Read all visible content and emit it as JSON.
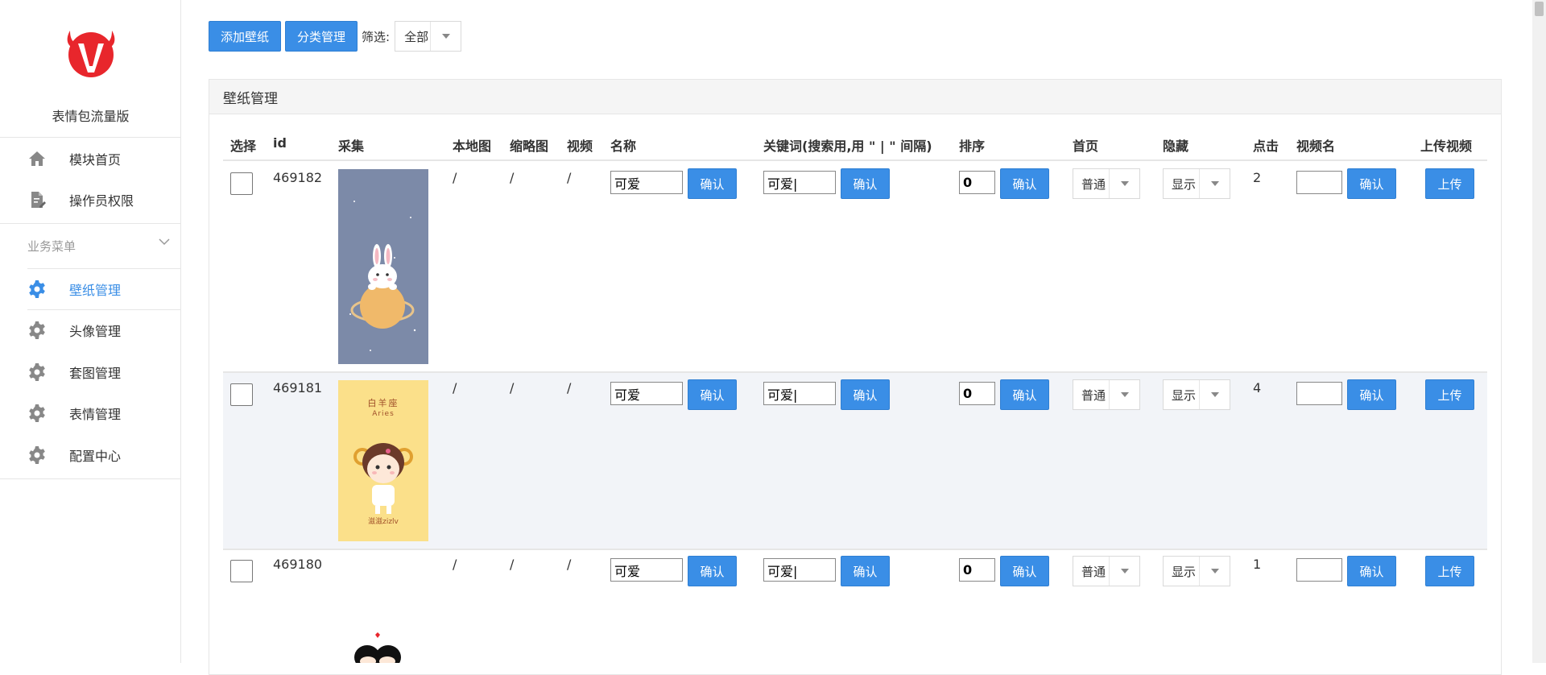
{
  "sidebar": {
    "brand": "表情包流量版",
    "top_items": [
      {
        "label": "模块首页",
        "icon": "home-icon"
      },
      {
        "label": "操作员权限",
        "icon": "document-edit-icon"
      }
    ],
    "group_title": "业务菜单",
    "group_items": [
      {
        "label": "壁纸管理",
        "icon": "gear-icon",
        "active": true
      },
      {
        "label": "头像管理",
        "icon": "gear-icon",
        "active": false
      },
      {
        "label": "套图管理",
        "icon": "gear-icon",
        "active": false
      },
      {
        "label": "表情管理",
        "icon": "gear-icon",
        "active": false
      },
      {
        "label": "配置中心",
        "icon": "gear-icon",
        "active": false
      }
    ]
  },
  "toolbar": {
    "add_label": "添加壁纸",
    "category_label": "分类管理",
    "filter_label": "筛选:",
    "filter_value": "全部"
  },
  "panel": {
    "title": "壁纸管理"
  },
  "table": {
    "columns": [
      "选择",
      "id",
      "采集",
      "本地图",
      "缩略图",
      "视频",
      "名称",
      "关键词(搜索用,用 \" | \" 间隔)",
      "排序",
      "首页",
      "隐藏",
      "点击",
      "视频名",
      "上传视频"
    ],
    "confirm_label": "确认",
    "upload_label": "上传",
    "rows": [
      {
        "id": "469182",
        "local": "/",
        "thumb": "/",
        "video": "/",
        "name": "可爱",
        "keywords": "可爱|",
        "sort": "0",
        "home": "普通",
        "hidden": "显示",
        "clicks": "2",
        "video_name": ""
      },
      {
        "id": "469181",
        "local": "/",
        "thumb": "/",
        "video": "/",
        "name": "可爱",
        "keywords": "可爱|",
        "sort": "0",
        "home": "普通",
        "hidden": "显示",
        "clicks": "4",
        "video_name": "",
        "image_text_top": "白羊座",
        "image_text_sub": "Aries",
        "image_text_bottom": "滋滋zizlv"
      },
      {
        "id": "469180",
        "local": "/",
        "thumb": "/",
        "video": "/",
        "name": "可爱",
        "keywords": "可爱|",
        "sort": "0",
        "home": "普通",
        "hidden": "显示",
        "clicks": "1",
        "video_name": ""
      }
    ]
  },
  "colors": {
    "accent": "#3a8ee6",
    "logo_red": "#e8262c",
    "alt_row": "#f2f4f8"
  }
}
